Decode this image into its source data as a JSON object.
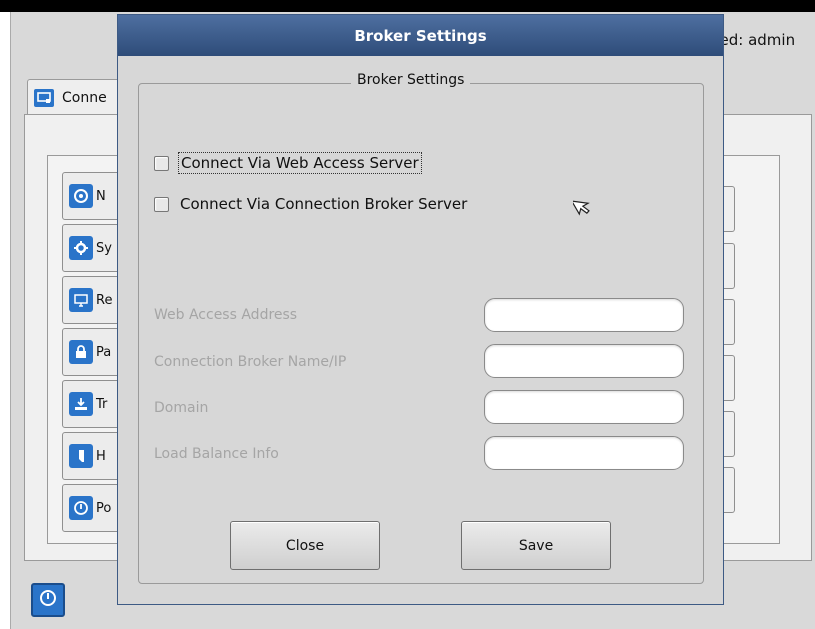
{
  "header": {
    "logged_text": "ged: admin"
  },
  "tab": {
    "label": "Conne"
  },
  "side_buttons": [
    {
      "label": "N",
      "icon": "network-icon"
    },
    {
      "label": "Sy",
      "icon": "system-gear-icon"
    },
    {
      "label": "Re",
      "icon": "remote-display-icon"
    },
    {
      "label": "Pa",
      "icon": "password-lock-icon"
    },
    {
      "label": "Tr",
      "icon": "transfer-icon"
    },
    {
      "label": "H",
      "icon": "help-icon"
    },
    {
      "label": "Po",
      "icon": "power-icon"
    }
  ],
  "dialog": {
    "title": "Broker Settings",
    "group_title": "Broker Settings",
    "checkboxes": [
      {
        "label": "Connect Via Web Access Server",
        "checked": false
      },
      {
        "label": "Connect Via Connection Broker Server",
        "checked": false
      }
    ],
    "fields": [
      {
        "label": "Web Access Address",
        "value": ""
      },
      {
        "label": "Connection Broker Name/IP",
        "value": ""
      },
      {
        "label": "Domain",
        "value": ""
      },
      {
        "label": "Load Balance Info",
        "value": ""
      }
    ],
    "buttons": {
      "close": "Close",
      "save": "Save"
    }
  },
  "colors": {
    "accent": "#2a74c9",
    "title_bar": "#3a5a8a",
    "disabled_text": "#a5a5a5"
  }
}
